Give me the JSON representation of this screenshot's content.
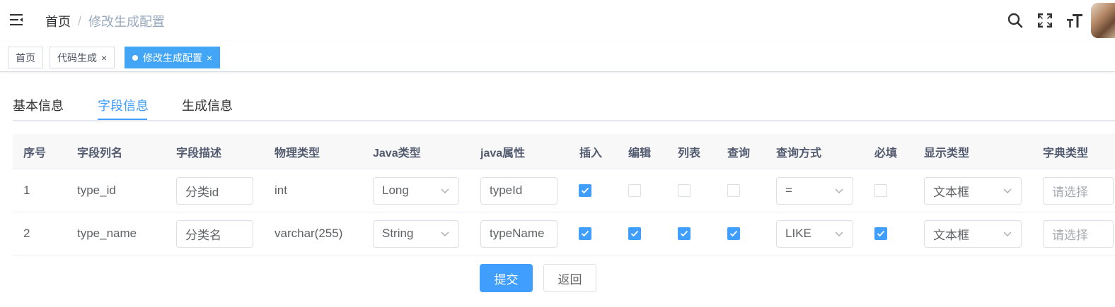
{
  "navbar": {
    "breadcrumb": [
      {
        "label": "首页"
      },
      {
        "label": "修改生成配置"
      }
    ],
    "separator": "/"
  },
  "tags": [
    {
      "label": "首页",
      "active": false,
      "closable": false
    },
    {
      "label": "代码生成",
      "active": false,
      "closable": true
    },
    {
      "label": "修改生成配置",
      "active": true,
      "closable": true
    }
  ],
  "tag_close_glyph": "×",
  "tabs": [
    {
      "label": "基本信息"
    },
    {
      "label": "字段信息",
      "active": true
    },
    {
      "label": "生成信息"
    }
  ],
  "table": {
    "headers": [
      "序号",
      "字段列名",
      "字段描述",
      "物理类型",
      "Java类型",
      "java属性",
      "插入",
      "编辑",
      "列表",
      "查询",
      "查询方式",
      "必填",
      "显示类型",
      "字典类型"
    ],
    "rows": [
      {
        "index": "1",
        "column_name": "type_id",
        "description": "分类id",
        "physical_type": "int",
        "java_type": "Long",
        "java_field": "typeId",
        "insert": true,
        "edit": false,
        "list": false,
        "query": false,
        "query_type": "=",
        "required": false,
        "html_type": "文本框",
        "dict_type_placeholder": "请选择"
      },
      {
        "index": "2",
        "column_name": "type_name",
        "description": "分类名",
        "physical_type": "varchar(255)",
        "java_type": "String",
        "java_field": "typeName",
        "insert": true,
        "edit": true,
        "list": true,
        "query": true,
        "query_type": "LIKE",
        "required": true,
        "html_type": "文本框",
        "dict_type_placeholder": "请选择"
      }
    ]
  },
  "buttons": {
    "submit": "提交",
    "back": "返回"
  },
  "colors": {
    "primary": "#409eff",
    "tag_active": "#42a5f5",
    "header_bg": "#f8f8f9"
  }
}
